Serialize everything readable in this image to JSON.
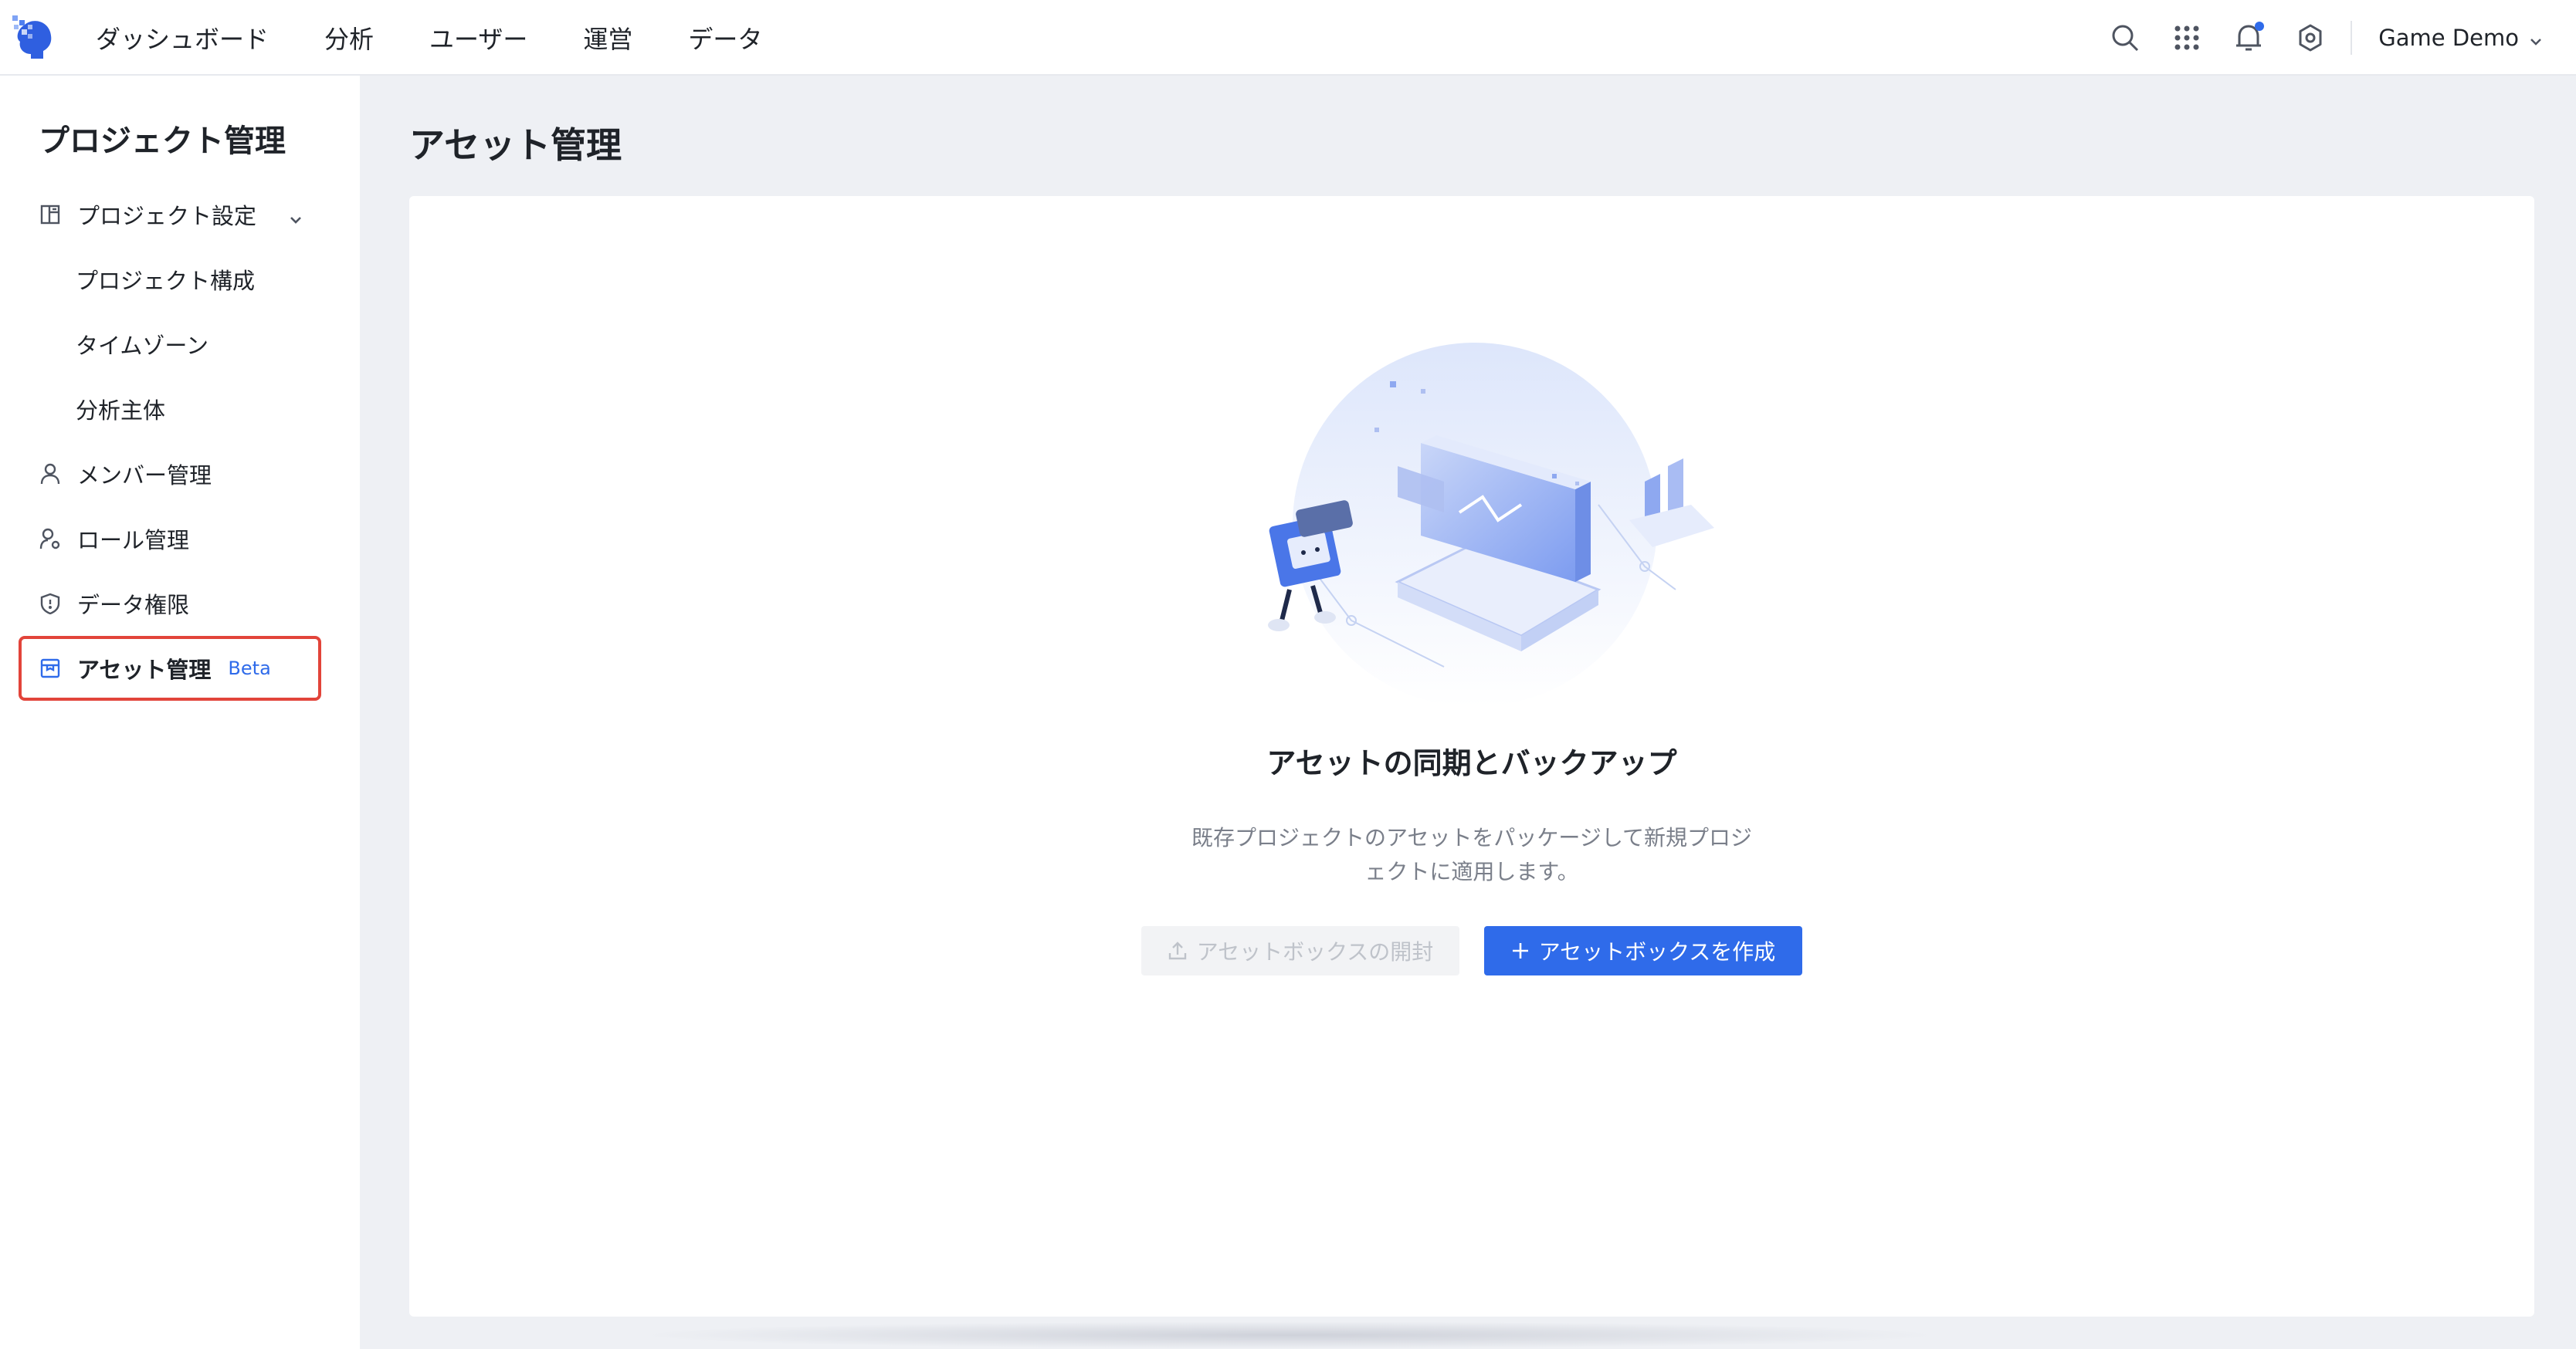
{
  "app": {
    "nav": [
      "ダッシュボード",
      "分析",
      "ユーザー",
      "運営",
      "データ"
    ],
    "project_name": "Game Demo",
    "accent_color": "#2f6bea",
    "icons": {
      "logo": "brain-logo-icon",
      "search": "search-icon",
      "apps": "app-grid-icon",
      "notifications": "bell-icon",
      "settings": "gear-icon"
    }
  },
  "sidebar": {
    "title": "プロジェクト管理",
    "items": [
      {
        "label": "プロジェクト設定",
        "icon": "layout-icon",
        "expanded": true
      },
      {
        "label": "プロジェクト構成"
      },
      {
        "label": "タイムゾーン"
      },
      {
        "label": "分析主体"
      },
      {
        "label": "メンバー管理",
        "icon": "user-icon"
      },
      {
        "label": "ロール管理",
        "icon": "user-role-icon"
      },
      {
        "label": "データ権限",
        "icon": "shield-icon"
      },
      {
        "label": "アセット管理",
        "icon": "box-icon",
        "badge": "Beta",
        "active": true
      }
    ]
  },
  "main": {
    "title": "アセット管理",
    "empty_state": {
      "title": "アセットの同期とバックアップ",
      "description": "既存プロジェクトのアセットをパッケージして新規プロジェクトに適用します。",
      "buttons": {
        "unpack": "アセットボックスの開封",
        "create": "アセットボックスを作成"
      }
    }
  }
}
